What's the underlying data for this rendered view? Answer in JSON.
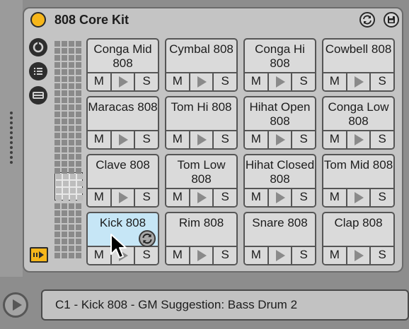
{
  "device": {
    "title": "808 Core Kit",
    "activator_color": "#f6b61a"
  },
  "pads": [
    {
      "name": "Conga Mid 808",
      "m": "M",
      "s": "S"
    },
    {
      "name": "Cymbal 808",
      "m": "M",
      "s": "S"
    },
    {
      "name": "Conga Hi 808",
      "m": "M",
      "s": "S"
    },
    {
      "name": "Cowbell 808",
      "m": "M",
      "s": "S"
    },
    {
      "name": "Maracas 808",
      "m": "M",
      "s": "S"
    },
    {
      "name": "Tom Hi 808",
      "m": "M",
      "s": "S"
    },
    {
      "name": "Hihat Open 808",
      "m": "M",
      "s": "S"
    },
    {
      "name": "Conga Low 808",
      "m": "M",
      "s": "S"
    },
    {
      "name": "Clave 808",
      "m": "M",
      "s": "S"
    },
    {
      "name": "Tom Low 808",
      "m": "M",
      "s": "S"
    },
    {
      "name": "Hihat Closed 808",
      "m": "M",
      "s": "S"
    },
    {
      "name": "Tom Mid 808",
      "m": "M",
      "s": "S"
    },
    {
      "name": "Kick 808",
      "m": "M",
      "s": "S",
      "selected": true
    },
    {
      "name": "Rim 808",
      "m": "M",
      "s": "S"
    },
    {
      "name": "Snare 808",
      "m": "M",
      "s": "S"
    },
    {
      "name": "Clap 808",
      "m": "M",
      "s": "S"
    }
  ],
  "selected_pad_color": "#c6e6f6",
  "status": {
    "text": "C1 - Kick 808 - GM Suggestion: Bass Drum 2"
  },
  "icons": {
    "activator": "device-activator-icon",
    "hot_swap": "hot-swap-icon",
    "save": "save-preset-icon",
    "macro": "macro-knob-icon",
    "chains": "chain-list-icon",
    "io": "input-output-icon",
    "auto_select": "auto-select-icon",
    "preview": "preview-play-icon"
  }
}
